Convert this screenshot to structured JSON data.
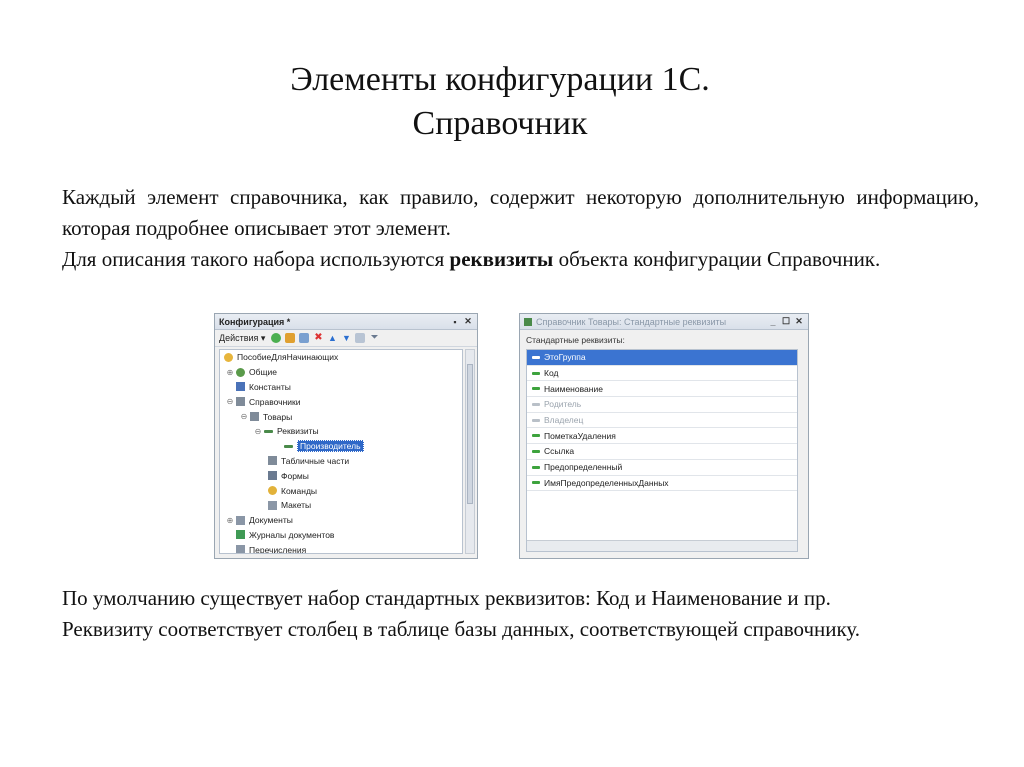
{
  "slide": {
    "title_line1": "Элементы конфигурации 1С.",
    "title_line2": "Справочник",
    "para1_line1": "Каждый элемент справочника, как правило, содержит некоторую дополнительную информацию, которая подробнее описывает этот элемент.",
    "para1_line2_before": "Для описания такого набора используются ",
    "para1_line2_bold": "реквизиты",
    "para1_line2_after": " объекта конфигурации Справочник.",
    "para2_line1": "По умолчанию существует набор стандартных реквизитов: Код и Наименование и пр.",
    "para2_line2": "Реквизиту соответствует столбец в таблице базы данных, соответствующей справочнику."
  },
  "config_window": {
    "title": "Конфигурация *",
    "actions_label": "Действия ▾",
    "tree": [
      {
        "label": "ПособиеДляНачинающих",
        "icon": "config-icon",
        "color": "#e7b53c"
      },
      {
        "label": "Общие",
        "icon": "common-icon",
        "color": "#5a9a4a"
      },
      {
        "label": "Константы",
        "icon": "constants-icon",
        "color": "#4a72b8"
      },
      {
        "label": "Справочники",
        "icon": "catalogs-icon",
        "color": "#7f8b99"
      },
      {
        "label": "Товары",
        "icon": "catalog-icon",
        "color": "#7f8b99"
      },
      {
        "label": "Реквизиты",
        "icon": "attributes-icon",
        "color": "#4a8a4a"
      },
      {
        "label": "Производитель",
        "icon": "attribute-icon",
        "color": "#4a8a4a"
      },
      {
        "label": "Табличные части",
        "icon": "table-parts-icon",
        "color": "#7f8b99"
      },
      {
        "label": "Формы",
        "icon": "forms-icon",
        "color": "#6a7a90"
      },
      {
        "label": "Команды",
        "icon": "commands-icon",
        "color": "#e2b23a"
      },
      {
        "label": "Макеты",
        "icon": "templates-icon",
        "color": "#8a96a6"
      },
      {
        "label": "Документы",
        "icon": "documents-icon",
        "color": "#8a96a6"
      },
      {
        "label": "Журналы документов",
        "icon": "journals-icon",
        "color": "#3f9a55"
      },
      {
        "label": "Перечисления",
        "icon": "enums-icon",
        "color": "#8a96a6"
      }
    ]
  },
  "std_window": {
    "title": "Справочник Товары: Стандартные реквизиты",
    "label": "Стандартные реквизиты:",
    "items": [
      {
        "label": "ЭтоГруппа",
        "color": "#ffffff"
      },
      {
        "label": "Код",
        "color": "#3da33d"
      },
      {
        "label": "Наименование",
        "color": "#3da33d"
      },
      {
        "label": "Родитель",
        "color": "#b9c0c8"
      },
      {
        "label": "Владелец",
        "color": "#b9c0c8"
      },
      {
        "label": "ПометкаУдаления",
        "color": "#3da33d"
      },
      {
        "label": "Ссылка",
        "color": "#3da33d"
      },
      {
        "label": "Предопределенный",
        "color": "#3da33d"
      },
      {
        "label": "ИмяПредопределенныхДанных",
        "color": "#3da33d"
      }
    ]
  }
}
